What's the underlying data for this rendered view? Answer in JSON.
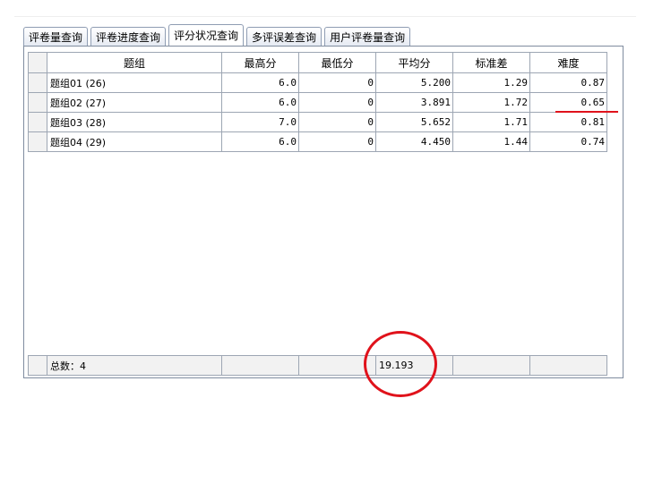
{
  "tabs": [
    {
      "label": "评卷量查询",
      "active": false
    },
    {
      "label": "评卷进度查询",
      "active": false
    },
    {
      "label": "评分状况查询",
      "active": true
    },
    {
      "label": "多评误差查询",
      "active": false
    },
    {
      "label": "用户评卷量查询",
      "active": false
    }
  ],
  "table": {
    "columns": [
      "题组",
      "最高分",
      "最低分",
      "平均分",
      "标准差",
      "难度"
    ],
    "rows": [
      [
        "题组01 (26)",
        "6.0",
        "0",
        "5.200",
        "1.29",
        "0.87"
      ],
      [
        "题组02 (27)",
        "6.0",
        "0",
        "3.891",
        "1.72",
        "0.65"
      ],
      [
        "题组03 (28)",
        "7.0",
        "0",
        "5.652",
        "1.71",
        "0.81"
      ],
      [
        "题组04 (29)",
        "6.0",
        "0",
        "4.450",
        "1.44",
        "0.74"
      ]
    ],
    "footer": [
      "总数：4",
      "",
      "",
      "19.193",
      "",
      ""
    ]
  },
  "colors": {
    "annotation": "#e0121b",
    "border": "#9da6b3"
  }
}
